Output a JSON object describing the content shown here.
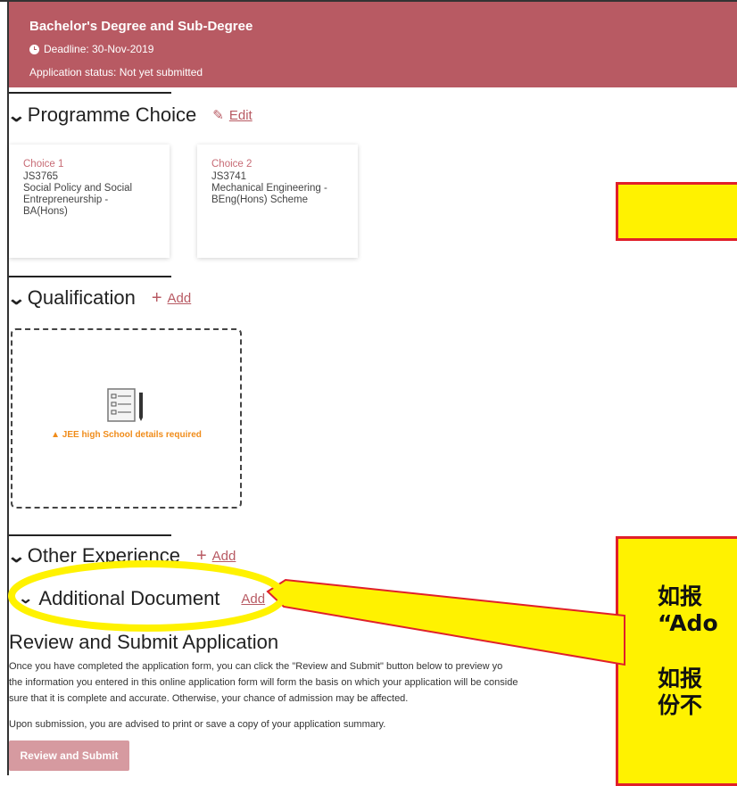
{
  "header": {
    "title": "Bachelor's Degree and Sub-Degree",
    "deadline": "Deadline: 30-Nov-2019",
    "status": "Application status: Not yet submitted"
  },
  "sections": {
    "programme_choice": {
      "title": "Programme Choice",
      "action": "Edit"
    },
    "qualification": {
      "title": "Qualification",
      "action": "Add"
    },
    "other_experience": {
      "title": "Other Experience",
      "action": "Add"
    },
    "additional_document": {
      "title": "Additional Document",
      "action": "Add"
    }
  },
  "choices": [
    {
      "label": "Choice 1",
      "code": "JS3765",
      "name": "Social Policy and Social Entrepreneurship - BA(Hons)"
    },
    {
      "label": "Choice 2",
      "code": "JS3741",
      "name": "Mechanical Engineering - BEng(Hons) Scheme"
    }
  ],
  "qualification_card": {
    "warning": "JEE high School details required"
  },
  "review": {
    "title": "Review and Submit Application",
    "p1": "Once you have completed the application form, you can click the \"Review and Submit\" button below to preview yo",
    "p2": "the information you entered in this online application form will form the basis on which your application will be conside",
    "p3": "sure that it is complete and accurate. Otherwise, your chance of admission may be affected.",
    "p4": "Upon submission, you are advised to print or save a copy of your application summary.",
    "button": "Review and Submit"
  },
  "callout": {
    "line1": "如报",
    "line2": "“Ado",
    "line3": "如报",
    "line4": "份不"
  },
  "colors": {
    "brand": "#b85a63",
    "callout_fill": "#fff200",
    "callout_border": "#e0202a"
  }
}
